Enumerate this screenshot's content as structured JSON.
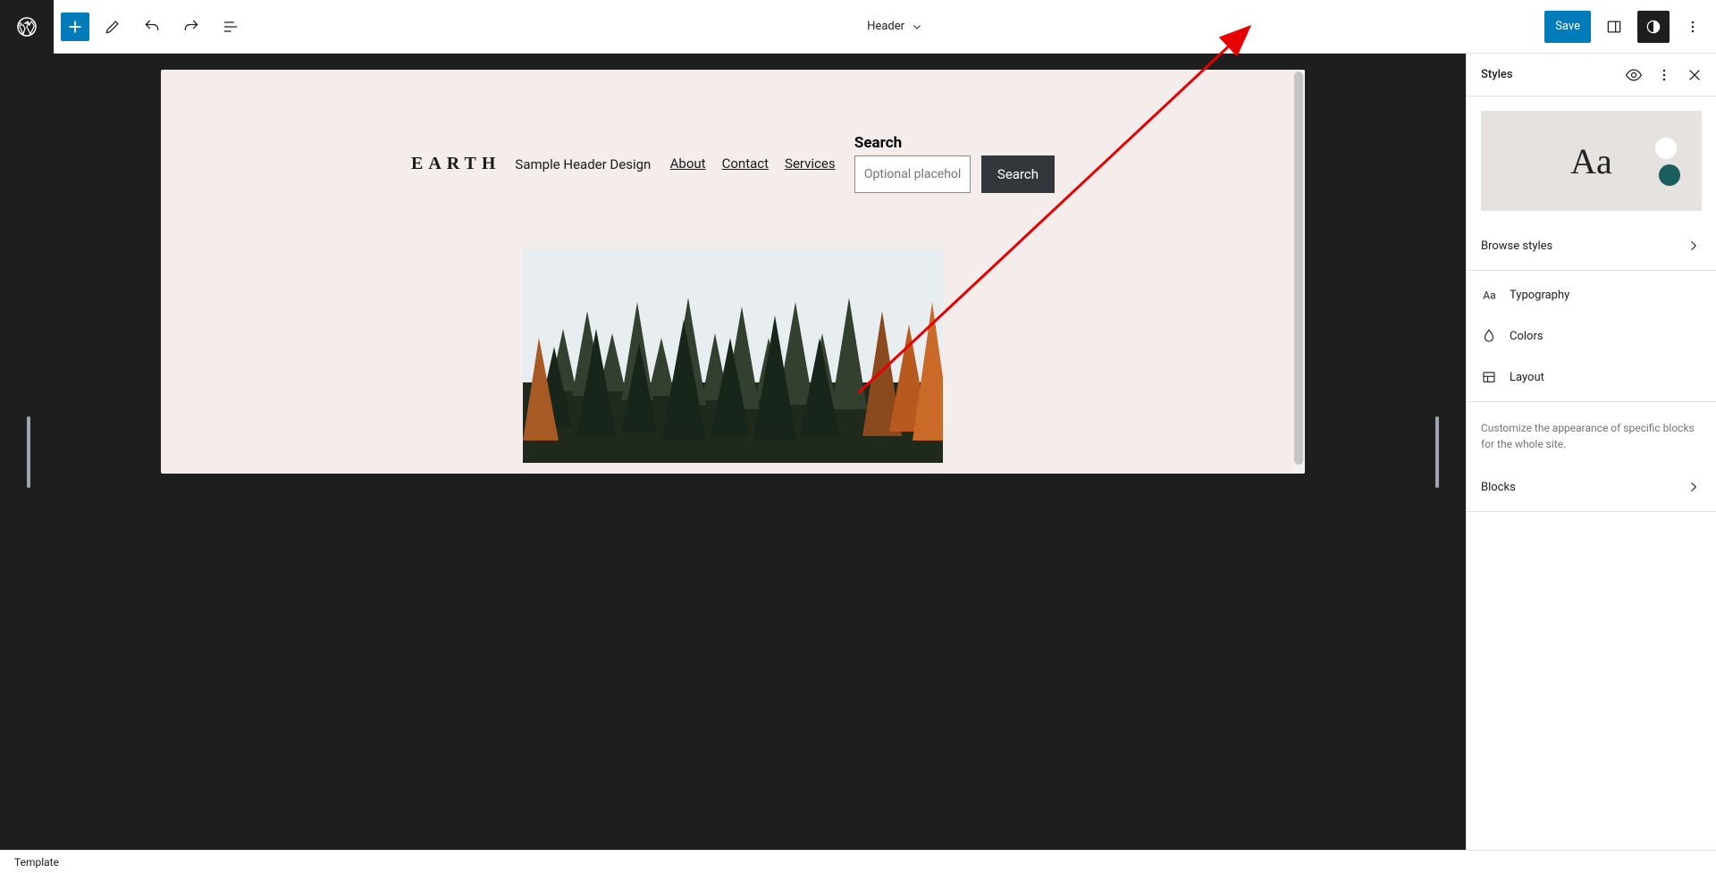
{
  "topbar": {
    "template_label": "Header",
    "save_label": "Save"
  },
  "page": {
    "site_title": "EARTH",
    "tagline": "Sample Header Design",
    "nav": [
      "About",
      "Contact",
      "Services"
    ],
    "search_label": "Search",
    "search_placeholder": "Optional placeholder…",
    "search_button": "Search"
  },
  "sidepanel": {
    "title": "Styles",
    "preview_glyph": "Aa",
    "browse_styles": "Browse styles",
    "typography": "Typography",
    "colors": "Colors",
    "layout": "Layout",
    "blocks_desc": "Customize the appearance of specific blocks for the whole site.",
    "blocks": "Blocks"
  },
  "footer": {
    "breadcrumb": "Template"
  },
  "colors": {
    "accent": "#007cba",
    "teal": "#1b5e60",
    "page_bg": "#f4edec"
  }
}
